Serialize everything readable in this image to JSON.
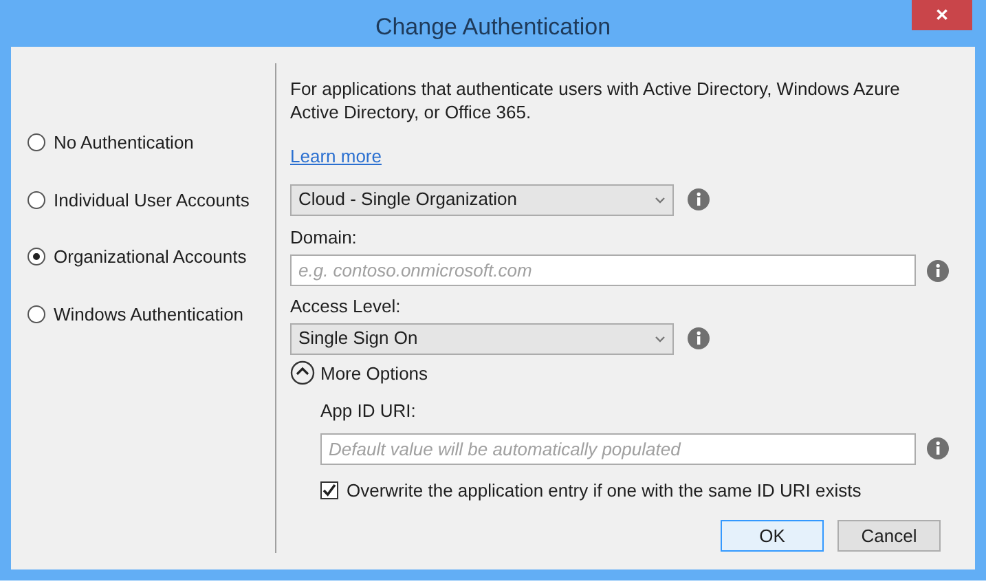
{
  "window": {
    "title": "Change Authentication",
    "close": "✕"
  },
  "auth_options": [
    {
      "label": "No Authentication",
      "selected": false
    },
    {
      "label": "Individual User Accounts",
      "selected": false
    },
    {
      "label": "Organizational Accounts",
      "selected": true
    },
    {
      "label": "Windows Authentication",
      "selected": false
    }
  ],
  "description": "For applications that authenticate users with Active Directory, Windows Azure Active Directory, or Office 365.",
  "learn_more": "Learn more",
  "account_type": {
    "value": "Cloud - Single Organization"
  },
  "domain": {
    "label": "Domain:",
    "placeholder": "e.g. contoso.onmicrosoft.com"
  },
  "access_level": {
    "label": "Access Level:",
    "value": "Single Sign On"
  },
  "more_options": {
    "label": "More Options",
    "expanded": true
  },
  "app_id_uri": {
    "label": "App ID URI:",
    "placeholder": "Default value will be automatically populated"
  },
  "overwrite": {
    "label": "Overwrite the application entry if one with the same ID URI exists",
    "checked": true
  },
  "buttons": [
    {
      "label": "OK",
      "default": true
    },
    {
      "label": "Cancel",
      "default": false
    }
  ]
}
